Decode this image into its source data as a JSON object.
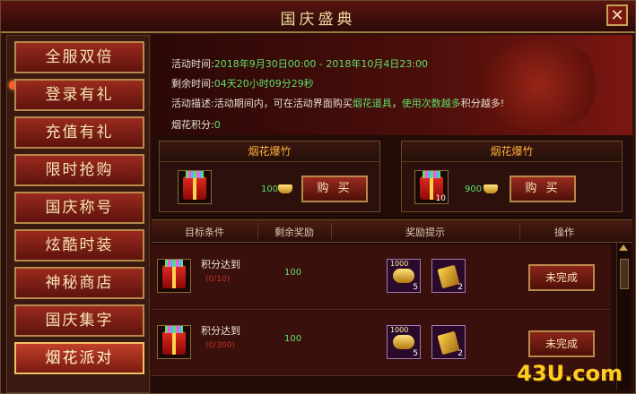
{
  "window": {
    "title": "国庆盛典",
    "close_label": "✕"
  },
  "sidebar": {
    "items": [
      {
        "label": "全服双倍"
      },
      {
        "label": "登录有礼"
      },
      {
        "label": "充值有礼"
      },
      {
        "label": "限时抢购"
      },
      {
        "label": "国庆称号"
      },
      {
        "label": "炫酷时装"
      },
      {
        "label": "神秘商店"
      },
      {
        "label": "国庆集字"
      },
      {
        "label": "烟花派对"
      }
    ],
    "active_index": 8
  },
  "info": {
    "time_label": "活动时间:",
    "time_value": "2018年9月30日00:00 - 2018年10月4日23:00",
    "remaining_label": "剩余时间:",
    "remaining_value": "04天20小时09分29秒",
    "desc_label": "活动描述:",
    "desc_part1": "活动期间内，可在活动界面购买",
    "desc_highlight1": "烟花道具",
    "desc_part2": "，",
    "desc_highlight2": "使用次数越多",
    "desc_part3": "积分越多!",
    "points_label": "烟花积分:",
    "points_value": "0"
  },
  "shop": [
    {
      "title": "烟花爆竹",
      "price": "100",
      "buy_label": "购 买",
      "count": ""
    },
    {
      "title": "烟花爆竹",
      "price": "900",
      "buy_label": "购 买",
      "count": "10"
    }
  ],
  "table": {
    "headers": [
      "目标条件",
      "剩余奖励",
      "奖励提示",
      "操作"
    ],
    "rows": [
      {
        "title": "积分达到",
        "progress": "(0/10)",
        "remaining": "100",
        "reward1_label": "1000",
        "reward1_count": "5",
        "reward2_count": "2",
        "status": "未完成"
      },
      {
        "title": "积分达到",
        "progress": "(0/300)",
        "remaining": "100",
        "reward1_label": "1000",
        "reward1_count": "5",
        "reward2_count": "2",
        "status": "未完成"
      }
    ]
  },
  "watermark": "43U.com",
  "colors": {
    "accent": "#b8894a",
    "highlight_green": "#5fe06a",
    "highlight_orange": "#ffb23a",
    "progress_red": "#c0302a"
  }
}
